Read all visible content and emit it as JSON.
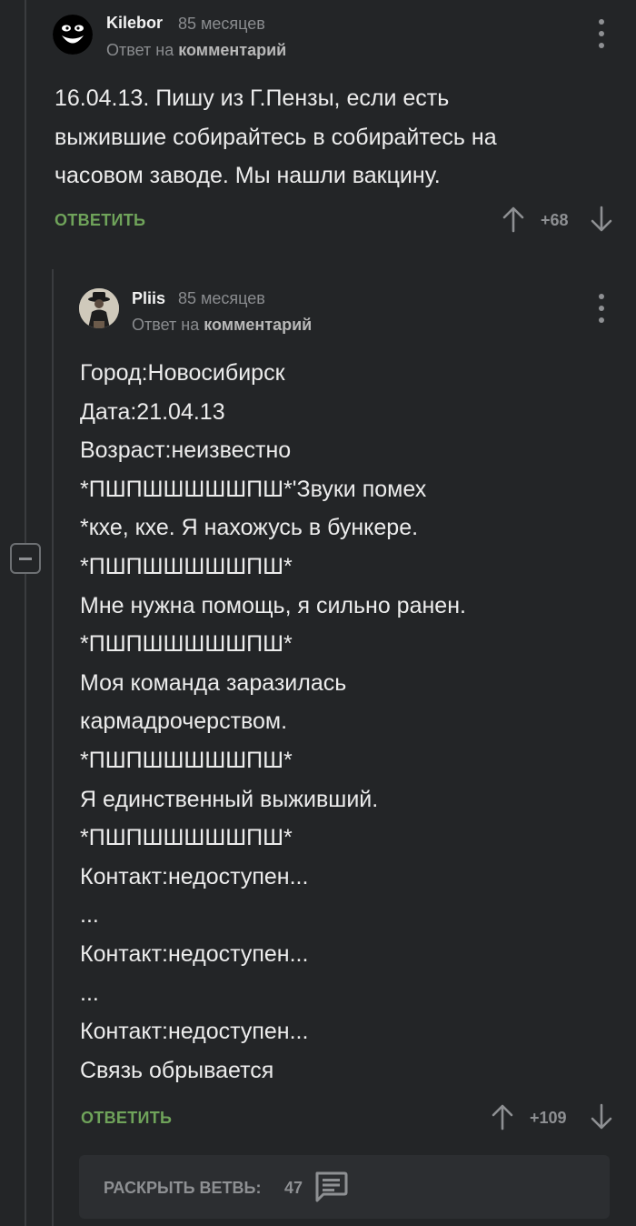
{
  "comment1": {
    "author": "Kilebor",
    "time": "85 месяцев",
    "reply_prefix": "Ответ на",
    "reply_link": "комментарий",
    "text_lines": [
      "16.04.13. Пишу из Г.Пензы, если есть",
      "выжившие собирайтесь в собирайтесь на",
      "часовом заводе. Мы нашли вакцину."
    ],
    "reply_label": "ОТВЕТИТЬ",
    "rating": "+68"
  },
  "comment2": {
    "author": "Pliis",
    "time": "85 месяцев",
    "reply_prefix": "Ответ на",
    "reply_link": "комментарий",
    "text_lines": [
      "Город:Новосибирск",
      "Дата:21.04.13",
      "Возраст:неизвестно",
      "*ПШПШШШШШПШ*'Звуки помех",
      "*кхе, кхе. Я нахожусь в бункере.",
      "*ПШПШШШШШПШ*",
      "Мне нужна помощь, я сильно ранен.",
      "*ПШПШШШШШПШ*",
      "Моя команда заразилась",
      "кармадрочерством.",
      "*ПШПШШШШШПШ*",
      "Я единственный выживший.",
      "*ПШПШШШШШПШ*",
      "Контакт:недоступен...",
      "...",
      "Контакт:недоступен...",
      "...",
      "Контакт:недоступен...",
      "Связь обрывается"
    ],
    "reply_label": "ОТВЕТИТЬ",
    "rating": "+109"
  },
  "branch": {
    "label": "РАСКРЫТЬ ВЕТВЬ:",
    "count": "47"
  },
  "icons": {
    "upvote": "arrow-up-icon",
    "downvote": "arrow-down-icon",
    "menu": "kebab-menu-icon",
    "collapse": "minus-icon",
    "comments": "comment-bubble-icon"
  },
  "colors": {
    "background": "#232527",
    "accent_green": "#6fa35a",
    "muted": "#8e9093",
    "text": "#ececec"
  }
}
